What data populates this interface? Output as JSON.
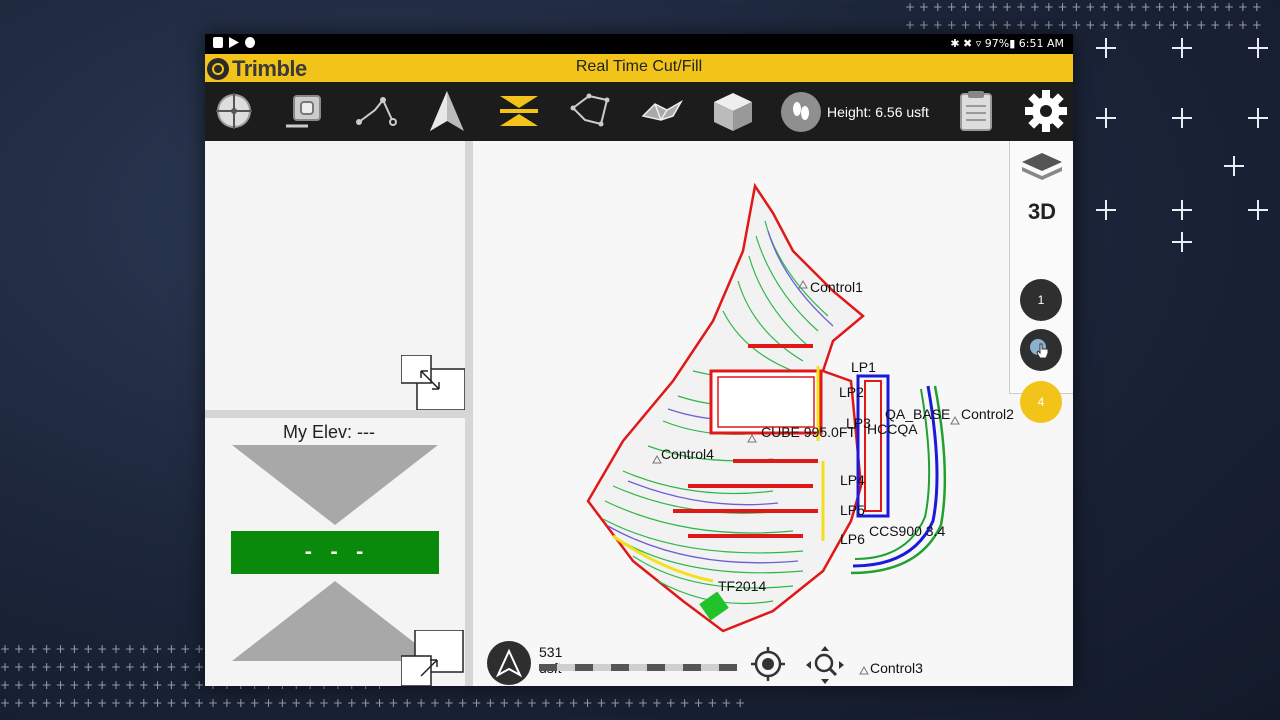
{
  "status_bar": {
    "right_text": "✱ ✖ ▿ 97%▮ 6:51 AM"
  },
  "title_bar": {
    "brand": "Trimble",
    "title": "Real Time Cut/Fill"
  },
  "toolbar": {
    "tools": [
      "measure-point-icon",
      "surface-scan-icon",
      "polyline-icon",
      "navigate-arrow-icon",
      "cut-fill-icon",
      "polygon-icon",
      "surface-icon",
      "cube-icon"
    ],
    "height_label": "Height: 6.56 usft",
    "height_icon": "footprints-icon",
    "clipboard_icon": "clipboard-icon",
    "settings_icon": "gear-icon"
  },
  "left_panel": {
    "my_elev_label": "My Elev: ---",
    "cutfill_value": "- - -",
    "cut_color": "#a8a8a8",
    "ongrade_color": "#0a8a0a"
  },
  "map": {
    "labels": {
      "control1": "Control1",
      "control2": "Control2",
      "control3": "Control3",
      "control4": "Control4",
      "lp1": "LP1",
      "lp2": "LP2",
      "lp3": "LP3",
      "lp4": "LP4",
      "lp5": "LP5",
      "lp6": "LP6",
      "qa_base": "QA_BASE",
      "hccqa": "HCCQA",
      "cube": "CUBE 995.0FT",
      "ccs": "CCS900 3.4",
      "tf2014": "TF2014"
    },
    "scale_text": "531 usft"
  },
  "right_rail": {
    "layers_icon": "layers-icon",
    "mode_3d": "3D",
    "buttons": [
      "1",
      "",
      "4"
    ]
  }
}
